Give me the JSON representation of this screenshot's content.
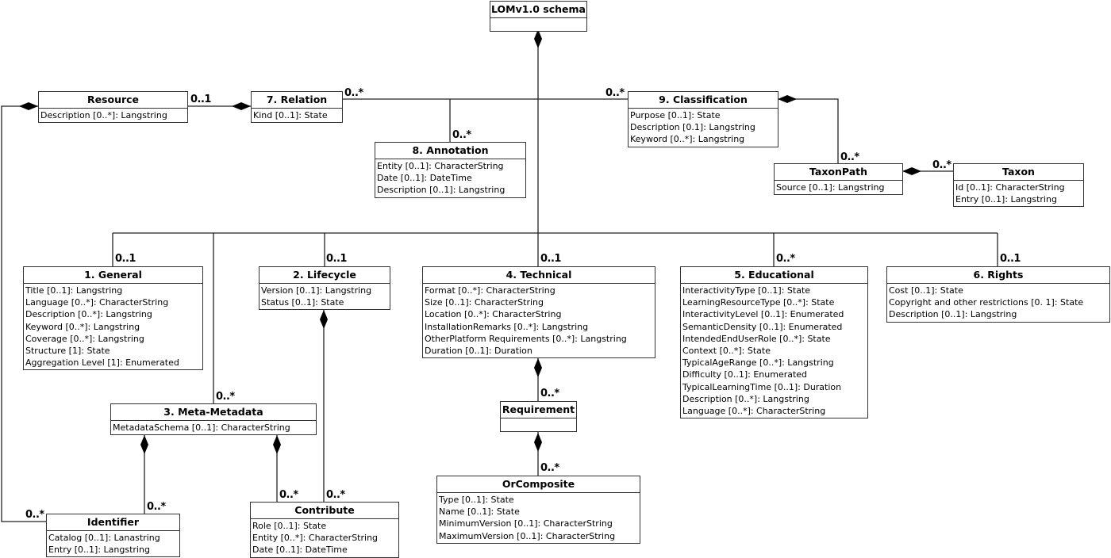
{
  "diagram": {
    "title": "LOMv1.0 schema",
    "classes": {
      "root": {
        "name": "LOMv1.0 schema",
        "attributes": []
      },
      "resource": {
        "name": "Resource",
        "attributes": [
          "Description [0..*]: Langstring"
        ]
      },
      "relation": {
        "name": "7. Relation",
        "attributes": [
          "Kind [0..1]: State"
        ]
      },
      "annotation": {
        "name": "8. Annotation",
        "attributes": [
          "Entity [0..1]: CharacterString",
          "Date [0..1]: DateTime",
          "Description [0..1]: Langstring"
        ]
      },
      "classification": {
        "name": "9. Classification",
        "attributes": [
          "Purpose [0..1]: State",
          "Description [0.1]: Langstring",
          "Keyword [0..*]: Langstring"
        ]
      },
      "taxonpath": {
        "name": "TaxonPath",
        "attributes": [
          "Source [0..1]: Langstring"
        ]
      },
      "taxon": {
        "name": "Taxon",
        "attributes": [
          "Id [0..1]: CharacterString",
          "Entry [0..1]: Langstring"
        ]
      },
      "general": {
        "name": "1. General",
        "attributes": [
          "Title [0..1]: Langstring",
          "Language [0..*]: CharacterString",
          "Description [0..*]: Langstring",
          "Keyword [0..*]: Langstring",
          "Coverage [0..*]: Langstring",
          "Structure [1]: State",
          "Aggregation Level [1]: Enumerated"
        ]
      },
      "lifecycle": {
        "name": "2. Lifecycle",
        "attributes": [
          "Version [0..1]: Langstring",
          "Status [0..1]: State"
        ]
      },
      "technical": {
        "name": "4. Technical",
        "attributes": [
          "Format [0..*]: CharacterString",
          "Size [0..1]: CharacterString",
          "Location [0..*]: CharacterString",
          "InstallationRemarks [0..*]: Langstring",
          "OtherPlatform Requirements [0..*]: Langstring",
          "Duration [0..1]: Duration"
        ]
      },
      "educational": {
        "name": "5. Educational",
        "attributes": [
          "InteractivityType [0..1]: State",
          "LearningResourceType [0..*]: State",
          "InteractivityLevel [0..1]: Enumerated",
          "SemanticDensity [0..1]: Enumerated",
          "IntendedEndUserRole [0..*]: State",
          "Context [0..*]: State",
          "TypicalAgeRange [0..*]: Langstring",
          "Difficulty [0..1]: Enumerated",
          "TypicalLearningTime [0..1]: Duration",
          "Description [0..*]: Langstring",
          "Language [0..*]: CharacterString"
        ]
      },
      "rights": {
        "name": "6. Rights",
        "attributes": [
          "Cost [0..1]: State",
          "Copyright and other restrictions [0. 1]: State",
          "Description [0..1]: Langstring"
        ]
      },
      "metametadata": {
        "name": "3. Meta-Metadata",
        "attributes": [
          "MetadataSchema [0..1]: CharacterString"
        ]
      },
      "requirement": {
        "name": "Requirement",
        "attributes": []
      },
      "orcomposite": {
        "name": "OrComposite",
        "attributes": [
          "Type [0..1]: State",
          "Name [0..1]: State",
          "MinimumVersion [0..1]: CharacterString",
          "MaximumVersion [0..1]: CharacterString"
        ]
      },
      "identifier": {
        "name": "Identifier",
        "attributes": [
          "Catalog [0..1]: Lanastring",
          "Entry [0..1]: Langstring"
        ]
      },
      "contribute": {
        "name": "Contribute",
        "attributes": [
          "Role [0..1]: State",
          "Entity [0..*]: CharacterString",
          "Date [0..1]: DateTime"
        ]
      }
    },
    "multiplicities": {
      "resource_relation": "0..1",
      "relation_root": "0..*",
      "annotation_root": "0..*",
      "classification_root": "0..*",
      "taxonpath_classification": "0..*",
      "taxon_taxonpath": "0..*",
      "general_root": "0..1",
      "lifecycle_root": "0..1",
      "technical_root": "0..1",
      "educational_root": "0..*",
      "rights_root": "0..1",
      "metametadata_root": "0..*",
      "requirement_technical": "0..*",
      "orcomposite_requirement": "0..*",
      "identifier_metametadata": "0..*",
      "identifier_resource": "0..*",
      "contribute_metametadata": "0..*",
      "contribute_lifecycle": "0..*"
    }
  }
}
